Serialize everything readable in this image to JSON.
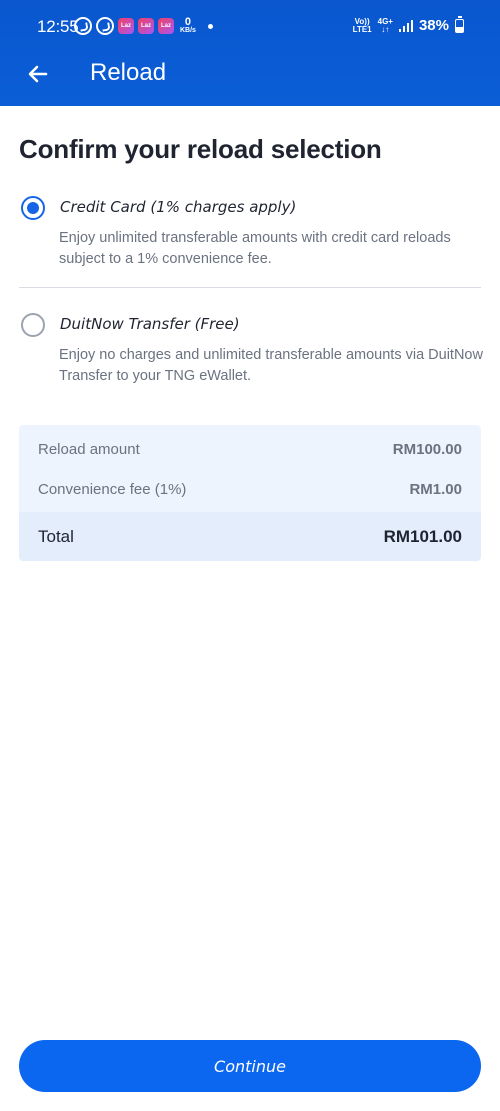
{
  "status_bar": {
    "time": "12:55",
    "app_icon_label": "Laz",
    "network_speed_value": "0",
    "network_speed_unit": "KB/s",
    "volte_top": "Vo))",
    "volte_bottom": "LTE1",
    "network_type": "4G+",
    "battery_percent": "38%"
  },
  "header": {
    "title": "Reload",
    "background_color": "#0b5ed7"
  },
  "page": {
    "heading": "Confirm your reload selection"
  },
  "options": [
    {
      "label": "Credit Card (1% charges apply)",
      "description": "Enjoy unlimited transferable amounts with credit card reloads subject to a 1% convenience fee.",
      "selected": true
    },
    {
      "label": "DuitNow Transfer (Free)",
      "description": "Enjoy no charges and unlimited transferable amounts via DuitNow Transfer to your TNG eWallet.",
      "selected": false
    }
  ],
  "summary": {
    "rows": [
      {
        "label": "Reload amount",
        "value": "RM100.00"
      },
      {
        "label": "Convenience fee (1%)",
        "value": "RM1.00"
      }
    ],
    "total_label": "Total",
    "total_value": "RM101.00"
  },
  "actions": {
    "continue_label": "Continue",
    "accent_color": "#0b66f0"
  },
  "icons": {
    "back": "arrow-left-icon",
    "radio_selected": "radio-checked-icon",
    "radio_unselected": "radio-unchecked-icon"
  }
}
